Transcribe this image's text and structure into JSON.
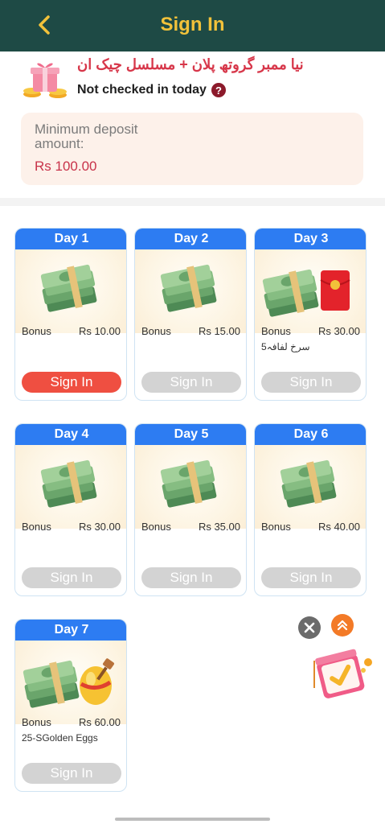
{
  "header": {
    "title": "Sign In",
    "back_icon": "chevron-left-icon"
  },
  "banner": {
    "urdu_text": "نیا ممبر گروتھ پلان + مسلسل چیک ان",
    "status_text": "Not checked in today",
    "help_icon": "question-icon"
  },
  "deposit": {
    "label": "Minimum deposit amount:",
    "value": "Rs 100.00"
  },
  "days": [
    {
      "label": "Day 1",
      "bonus_label": "Bonus",
      "bonus_value": "Rs 10.00",
      "extra": "",
      "button": "Sign In",
      "active": true,
      "rewards": [
        "cash"
      ]
    },
    {
      "label": "Day 2",
      "bonus_label": "Bonus",
      "bonus_value": "Rs 15.00",
      "extra": "",
      "button": "Sign In",
      "active": false,
      "rewards": [
        "cash"
      ]
    },
    {
      "label": "Day 3",
      "bonus_label": "Bonus",
      "bonus_value": "Rs 30.00",
      "extra": "سرخ لفافہ5",
      "button": "Sign In",
      "active": false,
      "rewards": [
        "cash",
        "red-envelope"
      ]
    },
    {
      "label": "Day 4",
      "bonus_label": "Bonus",
      "bonus_value": "Rs 30.00",
      "extra": "",
      "button": "Sign In",
      "active": false,
      "rewards": [
        "cash"
      ]
    },
    {
      "label": "Day 5",
      "bonus_label": "Bonus",
      "bonus_value": "Rs 35.00",
      "extra": "",
      "button": "Sign In",
      "active": false,
      "rewards": [
        "cash"
      ]
    },
    {
      "label": "Day 6",
      "bonus_label": "Bonus",
      "bonus_value": "Rs 40.00",
      "extra": "",
      "button": "Sign In",
      "active": false,
      "rewards": [
        "cash"
      ]
    },
    {
      "label": "Day 7",
      "bonus_label": "Bonus",
      "bonus_value": "Rs 60.00",
      "extra": "25-SGolden Eggs",
      "button": "Sign In",
      "active": false,
      "rewards": [
        "cash",
        "golden-egg"
      ]
    }
  ],
  "colors": {
    "header_bg": "#1e4a45",
    "title": "#f2c23a",
    "day_tab": "#2d7cf2",
    "active_button": "#ef4f41",
    "inactive_button": "#d3d3d3",
    "deposit_value": "#c8334a"
  },
  "floating": {
    "close_icon": "close-icon",
    "scroll_up_icon": "double-chevron-up-icon",
    "gift_icon": "gift-box-icon"
  }
}
